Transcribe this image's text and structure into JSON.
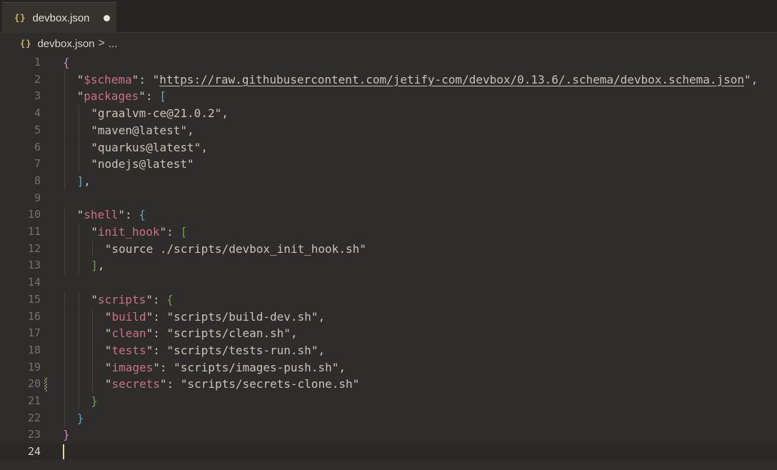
{
  "tab": {
    "icon": "{}",
    "label": "devbox.json"
  },
  "breadcrumb": {
    "icon": "{}",
    "file": "devbox.json",
    "separator": ">",
    "more": "..."
  },
  "editor": {
    "current_line": 24,
    "lines": [
      {
        "n": "1",
        "indent": 0,
        "tokens": [
          {
            "t": "{",
            "c": "k-brace"
          }
        ]
      },
      {
        "n": "2",
        "indent": 1,
        "tokens": [
          {
            "t": "\"",
            "c": "k-q"
          },
          {
            "t": "$schema",
            "c": "k-key"
          },
          {
            "t": "\"",
            "c": "k-q"
          },
          {
            "t": ": ",
            "c": "k-punc"
          },
          {
            "t": "\"",
            "c": "k-q"
          },
          {
            "t": "https://raw.githubusercontent.com/jetify-com/devbox/0.13.6/.schema/devbox.schema.json",
            "c": "k-url"
          },
          {
            "t": "\"",
            "c": "k-q"
          },
          {
            "t": ",",
            "c": "k-punc"
          }
        ]
      },
      {
        "n": "3",
        "indent": 1,
        "tokens": [
          {
            "t": "\"",
            "c": "k-q"
          },
          {
            "t": "packages",
            "c": "k-key"
          },
          {
            "t": "\"",
            "c": "k-q"
          },
          {
            "t": ": ",
            "c": "k-punc"
          },
          {
            "t": "[",
            "c": "k-bracket"
          }
        ]
      },
      {
        "n": "4",
        "indent": 2,
        "tokens": [
          {
            "t": "\"graalvm-ce@21.0.2\"",
            "c": "k-str"
          },
          {
            "t": ",",
            "c": "k-punc"
          }
        ]
      },
      {
        "n": "5",
        "indent": 2,
        "tokens": [
          {
            "t": "\"maven@latest\"",
            "c": "k-str"
          },
          {
            "t": ",",
            "c": "k-punc"
          }
        ]
      },
      {
        "n": "6",
        "indent": 2,
        "tokens": [
          {
            "t": "\"quarkus@latest\"",
            "c": "k-str"
          },
          {
            "t": ",",
            "c": "k-punc"
          }
        ]
      },
      {
        "n": "7",
        "indent": 2,
        "tokens": [
          {
            "t": "\"nodejs@latest\"",
            "c": "k-str"
          }
        ]
      },
      {
        "n": "8",
        "indent": 1,
        "tokens": [
          {
            "t": "]",
            "c": "k-bracket"
          },
          {
            "t": ",",
            "c": "k-punc"
          }
        ]
      },
      {
        "n": "9",
        "indent": 0,
        "tokens": []
      },
      {
        "n": "10",
        "indent": 1,
        "tokens": [
          {
            "t": "\"",
            "c": "k-q"
          },
          {
            "t": "shell",
            "c": "k-key"
          },
          {
            "t": "\"",
            "c": "k-q"
          },
          {
            "t": ": ",
            "c": "k-punc"
          },
          {
            "t": "{",
            "c": "k-brace2"
          }
        ]
      },
      {
        "n": "11",
        "indent": 2,
        "tokens": [
          {
            "t": "\"",
            "c": "k-q"
          },
          {
            "t": "init_hook",
            "c": "k-key"
          },
          {
            "t": "\"",
            "c": "k-q"
          },
          {
            "t": ": ",
            "c": "k-punc"
          },
          {
            "t": "[",
            "c": "k-brace3"
          }
        ]
      },
      {
        "n": "12",
        "indent": 3,
        "tokens": [
          {
            "t": "\"source ./scripts/devbox_init_hook.sh\"",
            "c": "k-str"
          }
        ]
      },
      {
        "n": "13",
        "indent": 2,
        "tokens": [
          {
            "t": "]",
            "c": "k-brace3"
          },
          {
            "t": ",",
            "c": "k-punc"
          }
        ]
      },
      {
        "n": "14",
        "indent": 0,
        "tokens": []
      },
      {
        "n": "15",
        "indent": 2,
        "tokens": [
          {
            "t": "\"",
            "c": "k-q"
          },
          {
            "t": "scripts",
            "c": "k-key"
          },
          {
            "t": "\"",
            "c": "k-q"
          },
          {
            "t": ": ",
            "c": "k-punc"
          },
          {
            "t": "{",
            "c": "k-brace3"
          }
        ]
      },
      {
        "n": "16",
        "indent": 3,
        "tokens": [
          {
            "t": "\"",
            "c": "k-q"
          },
          {
            "t": "build",
            "c": "k-key"
          },
          {
            "t": "\"",
            "c": "k-q"
          },
          {
            "t": ": ",
            "c": "k-punc"
          },
          {
            "t": "\"scripts/build-dev.sh\"",
            "c": "k-str"
          },
          {
            "t": ",",
            "c": "k-punc"
          }
        ]
      },
      {
        "n": "17",
        "indent": 3,
        "tokens": [
          {
            "t": "\"",
            "c": "k-q"
          },
          {
            "t": "clean",
            "c": "k-key"
          },
          {
            "t": "\"",
            "c": "k-q"
          },
          {
            "t": ": ",
            "c": "k-punc"
          },
          {
            "t": "\"scripts/clean.sh\"",
            "c": "k-str"
          },
          {
            "t": ",",
            "c": "k-punc"
          }
        ]
      },
      {
        "n": "18",
        "indent": 3,
        "tokens": [
          {
            "t": "\"",
            "c": "k-q"
          },
          {
            "t": "tests",
            "c": "k-key"
          },
          {
            "t": "\"",
            "c": "k-q"
          },
          {
            "t": ": ",
            "c": "k-punc"
          },
          {
            "t": "\"scripts/tests-run.sh\"",
            "c": "k-str"
          },
          {
            "t": ",",
            "c": "k-punc"
          }
        ]
      },
      {
        "n": "19",
        "indent": 3,
        "tokens": [
          {
            "t": "\"",
            "c": "k-q"
          },
          {
            "t": "images",
            "c": "k-key"
          },
          {
            "t": "\"",
            "c": "k-q"
          },
          {
            "t": ": ",
            "c": "k-punc"
          },
          {
            "t": "\"scripts/images-push.sh\"",
            "c": "k-str"
          },
          {
            "t": ",",
            "c": "k-punc"
          }
        ]
      },
      {
        "n": "20",
        "indent": 3,
        "modified": true,
        "tokens": [
          {
            "t": "\"",
            "c": "k-q"
          },
          {
            "t": "secrets",
            "c": "k-key"
          },
          {
            "t": "\"",
            "c": "k-q"
          },
          {
            "t": ": ",
            "c": "k-punc"
          },
          {
            "t": "\"scripts/secrets-clone.sh\"",
            "c": "k-str"
          }
        ]
      },
      {
        "n": "21",
        "indent": 2,
        "tokens": [
          {
            "t": "}",
            "c": "k-brace3"
          }
        ]
      },
      {
        "n": "22",
        "indent": 1,
        "tokens": [
          {
            "t": "}",
            "c": "k-brace2"
          }
        ]
      },
      {
        "n": "23",
        "indent": 0,
        "tokens": [
          {
            "t": "}",
            "c": "k-brace"
          }
        ]
      },
      {
        "n": "24",
        "indent": 0,
        "tokens": []
      }
    ]
  },
  "colors": {
    "key": "#c7728a",
    "string": "#c9c3b8",
    "brace_level1": "#c487b6",
    "brace_level2": "#5fa3c0",
    "brace_level3": "#6aa34e",
    "accent_icon": "#d7ba4f"
  }
}
